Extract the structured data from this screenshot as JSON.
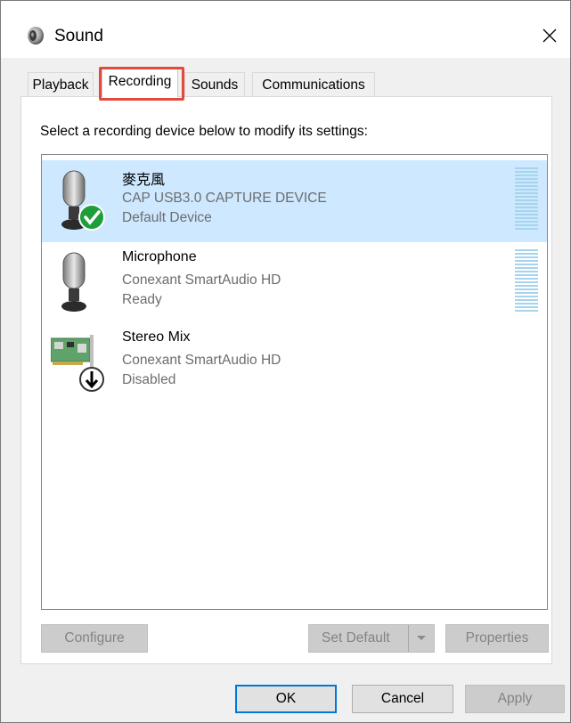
{
  "window": {
    "title": "Sound",
    "close_glyph": "✕"
  },
  "tabs": [
    {
      "label": "Playback",
      "active": false
    },
    {
      "label": "Recording",
      "active": true
    },
    {
      "label": "Sounds",
      "active": false
    },
    {
      "label": "Communications",
      "active": false
    }
  ],
  "main": {
    "instructions": "Select a recording device below to modify its settings:"
  },
  "devices": [
    {
      "name": "麥克風",
      "description": "CAP USB3.0 CAPTURE DEVICE",
      "status": "Default Device",
      "icon": "microphone-icon",
      "badge": "default-check-icon",
      "selected": true,
      "level": 0
    },
    {
      "name": "Microphone",
      "description": "Conexant SmartAudio HD",
      "status": "Ready",
      "icon": "microphone-icon",
      "badge": null,
      "selected": false,
      "level": 0
    },
    {
      "name": "Stereo Mix",
      "description": "Conexant SmartAudio HD",
      "status": "Disabled",
      "icon": "sound-card-icon",
      "badge": "disabled-arrow-icon",
      "selected": false,
      "level": null
    }
  ],
  "buttons": {
    "configure": "Configure",
    "set_default": "Set Default",
    "properties": "Properties",
    "ok": "OK",
    "cancel": "Cancel",
    "apply": "Apply"
  },
  "colors": {
    "selection": "#cde8ff",
    "highlight_box": "#e24a3b",
    "check_badge": "#1e9e3a",
    "accent": "#0078d7"
  }
}
